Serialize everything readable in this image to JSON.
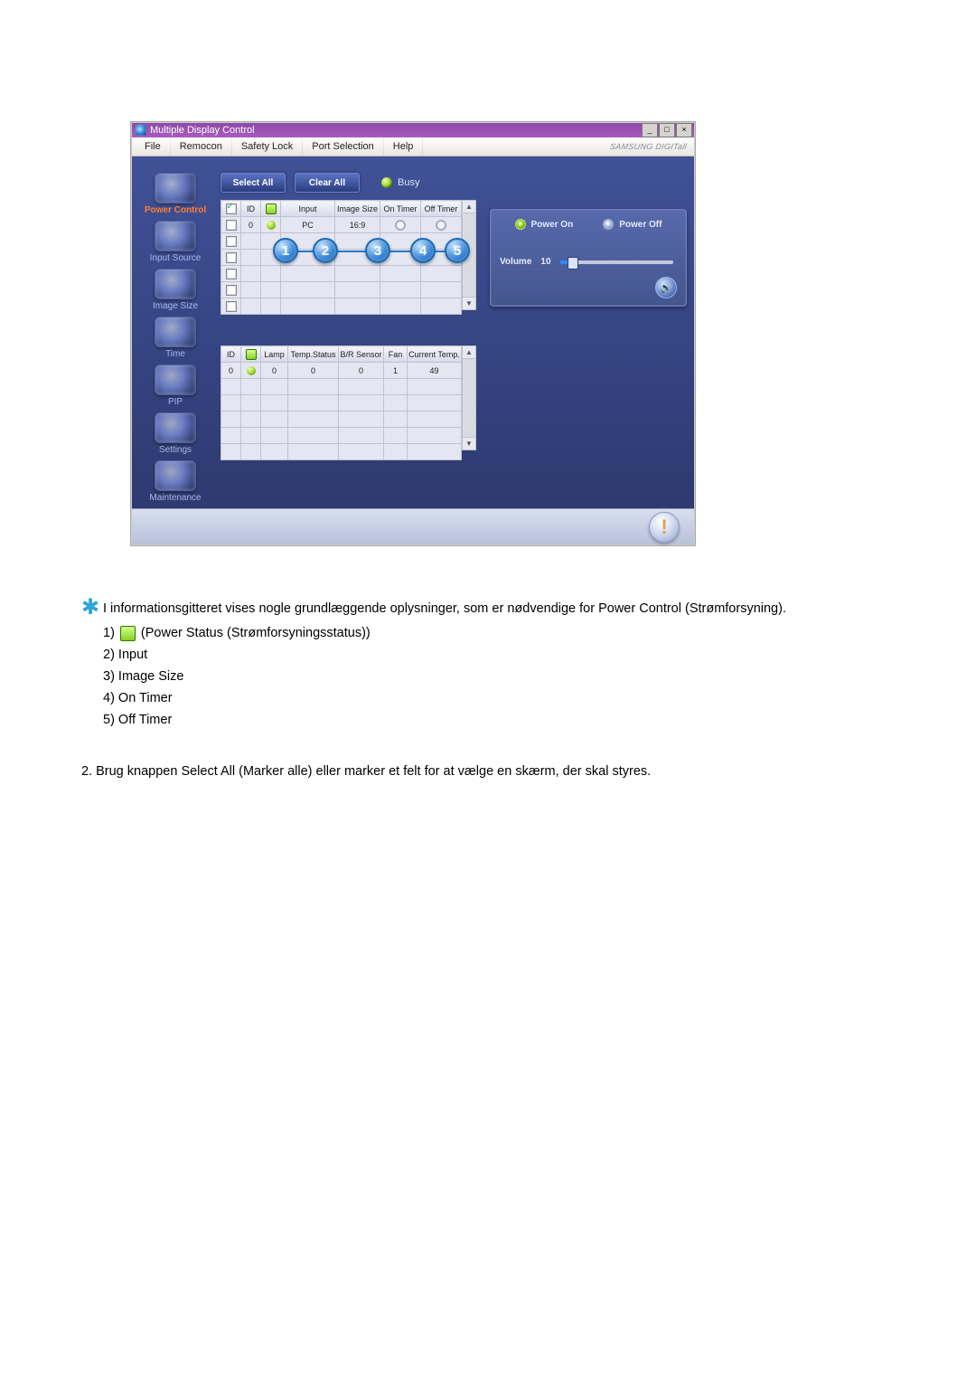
{
  "window": {
    "title": "Multiple Display Control",
    "brand": "SAMSUNG DIGITall"
  },
  "menu": [
    "File",
    "Remocon",
    "Safety Lock",
    "Port Selection",
    "Help"
  ],
  "sidebar": [
    {
      "label": "Power Control",
      "active": true
    },
    {
      "label": "Input Source"
    },
    {
      "label": "Image Size"
    },
    {
      "label": "Time"
    },
    {
      "label": "PIP"
    },
    {
      "label": "Settings"
    },
    {
      "label": "Maintenance"
    }
  ],
  "toolbar": {
    "select_all": "Select All",
    "clear_all": "Clear All",
    "busy": "Busy",
    "power_on": "Power On",
    "power_off": "Power Off"
  },
  "display_grid": {
    "headers": [
      "",
      "ID",
      "",
      "Input",
      "Image Size",
      "On Timer",
      "Off Timer"
    ],
    "rows": [
      {
        "checked": true,
        "id": "0",
        "status": "on",
        "input": "PC",
        "image_size": "16:9",
        "on_timer": "○",
        "off_timer": "○"
      },
      {
        "checked": false,
        "id": "",
        "status": "",
        "input": "",
        "image_size": "",
        "on_timer": "",
        "off_timer": ""
      },
      {
        "checked": false,
        "id": "",
        "status": "",
        "input": "",
        "image_size": "",
        "on_timer": "",
        "off_timer": ""
      },
      {
        "checked": false,
        "id": "",
        "status": "",
        "input": "",
        "image_size": "",
        "on_timer": "",
        "off_timer": ""
      },
      {
        "checked": false,
        "id": "",
        "status": "",
        "input": "",
        "image_size": "",
        "on_timer": "",
        "off_timer": ""
      },
      {
        "checked": false,
        "id": "",
        "status": "",
        "input": "",
        "image_size": "",
        "on_timer": "",
        "off_timer": ""
      }
    ]
  },
  "status_grid": {
    "headers": [
      "ID",
      "",
      "Lamp",
      "Temp.Status",
      "B/R Sensor",
      "Fan",
      "Current Temp."
    ],
    "rows": [
      {
        "id": "0",
        "status": "on",
        "lamp": "0",
        "temp_status": "0",
        "br_sensor": "0",
        "fan": "1",
        "current_temp": "49"
      },
      {},
      {},
      {},
      {},
      {}
    ]
  },
  "callouts": [
    "1",
    "2",
    "3",
    "4",
    "5"
  ],
  "right_panel": {
    "volume_label": "Volume",
    "volume_value": "10"
  },
  "explain": {
    "intro": "I informationsgitteret vises nogle grundlæggende oplysninger, som er nødvendige for Power Control (Strømforsyning).",
    "items": {
      "i1a": "1)",
      "i1b": "(Power Status (Strømforsyningsstatus))",
      "i2": "2) Input",
      "i3": "3) Image Size",
      "i4": "4) On Timer",
      "i5": "5) Off Timer"
    },
    "para2": "2.  Brug knappen Select All (Marker alle) eller marker et felt for at vælge en skærm, der skal styres."
  }
}
